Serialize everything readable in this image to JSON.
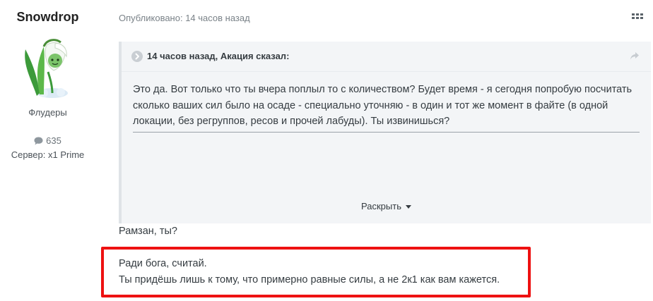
{
  "author": {
    "name": "Snowdrop",
    "group": "Флудеры",
    "post_count": "635",
    "server": "Сервер: x1 Prime",
    "avatar_icon": "snowdrop-flower-avatar"
  },
  "post": {
    "published": "Опубликовано: 14 часов назад",
    "quote": {
      "citation": "14 часов назад, Акация сказал:",
      "body": "Это да. Вот только что ты вчера поплыл то с количеством? Будет время - я сегодня попробую посчитать сколько ваших сил было на осаде - специально уточняю - в один и тот же момент в файте (в одной локации, без регруппов, ресов и прочей лабуды). Ты извинишься?",
      "expand_label": "Раскрыть"
    },
    "reply_line": "Рамзан, ты?",
    "highlighted": {
      "line1": "Ради бога, считай.",
      "line2": "Ты придёшь лишь к тому, что примерно равные силы, а не 2к1 как вам кажется."
    }
  },
  "colors": {
    "highlight_border": "#ee1111",
    "quote_bg": "#f3f5f7",
    "text": "#353c41"
  }
}
